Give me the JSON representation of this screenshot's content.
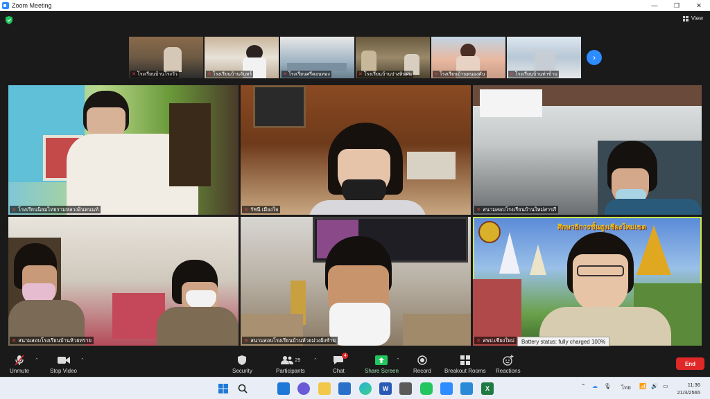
{
  "window": {
    "title": "Zoom Meeting",
    "minimize": "—",
    "maximize": "❐",
    "close": "✕"
  },
  "topbar": {
    "view_label": "View"
  },
  "thumbnails": [
    {
      "name": "โรงเรียนบ้านโรงวัว"
    },
    {
      "name": "โรงเรียนบ้านจันทร์"
    },
    {
      "name": "โรงเรียนศรีดอนทอง"
    },
    {
      "name": "โรงเรียนบ้านปางหินฝน"
    },
    {
      "name": "โรงเรียนบ้านหนองคัน"
    },
    {
      "name": "โรงเรียนบ้านท่าข้าม"
    }
  ],
  "tiles": [
    {
      "name": "โรงเรียนนิยมไทยรามหลวงอินทนนท์"
    },
    {
      "name": "รัชนี เมืองใจ"
    },
    {
      "name": "สนามสอบโรงเรียนบ้านใหม่สารภี"
    },
    {
      "name": "สนามสอบโรงเรียนบ้านห้วยทราย"
    },
    {
      "name": "สนามสอบโรงเรียนบ้านห้วยม่วงฝั่งซ้าย"
    },
    {
      "name": "สพป.เชียงใหม่",
      "banner": "ศึกษาธิการชั้นสูงเชียงใหม่เขต"
    }
  ],
  "tooltip": "Battery status: fully charged 100%",
  "toolbar": {
    "unmute": "Unmute",
    "stop_video": "Stop Video",
    "security": "Security",
    "participants": "Participants",
    "participants_count": "29",
    "chat": "Chat",
    "chat_badge": "4",
    "share_screen": "Share Screen",
    "record": "Record",
    "breakout_rooms": "Breakout Rooms",
    "reactions": "Reactions",
    "end": "End"
  },
  "taskbar": {
    "lang": "ไทย",
    "time": "11:36",
    "date": "21/3/2565"
  },
  "colors": {
    "zoom_blue": "#2d8cff",
    "end_red": "#e02828",
    "share_green": "#22c55e",
    "active_speaker": "#c9e84a"
  }
}
